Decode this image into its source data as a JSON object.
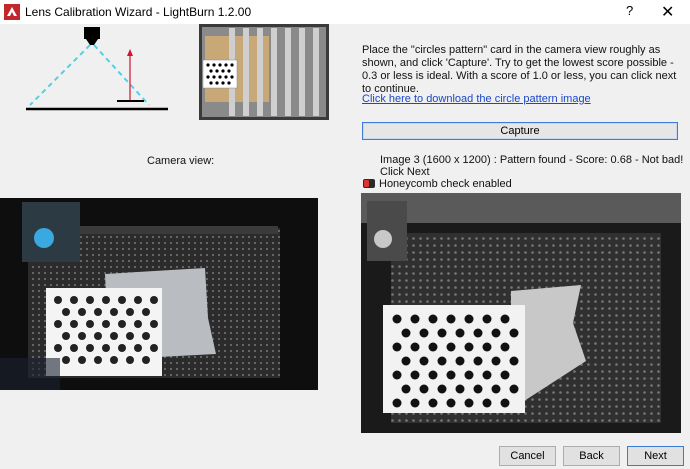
{
  "window": {
    "title": "Lens Calibration Wizard - LightBurn 1.2.00",
    "help_label": "?",
    "close_label": "✕"
  },
  "instructions": {
    "text": "Place the \"circles pattern\" card in the camera view roughly as shown, and click 'Capture'. Try to get the lowest score possible - 0.3 or less is ideal. With a score of 1.0 or less, you can click next to continue.",
    "download_link": "Click here to download the circle pattern image"
  },
  "capture": {
    "label": "Capture",
    "status": "Image 3 (1600 x 1200) : Pattern found - Score: 0.68 - Not bad! Click Next"
  },
  "camera_view": {
    "label": "Camera view:"
  },
  "honeycomb": {
    "label": "Honeycomb check enabled",
    "enabled": false
  },
  "footer": {
    "cancel": "Cancel",
    "back": "Back",
    "next": "Next"
  },
  "colors": {
    "accent": "#3d7bd4",
    "link": "#1a47c8",
    "laser_beam": "#4fd0e8",
    "arrow": "#d0142c",
    "toggle": "#dd3333"
  },
  "icons": {
    "app": "lightburn-logo-icon"
  }
}
